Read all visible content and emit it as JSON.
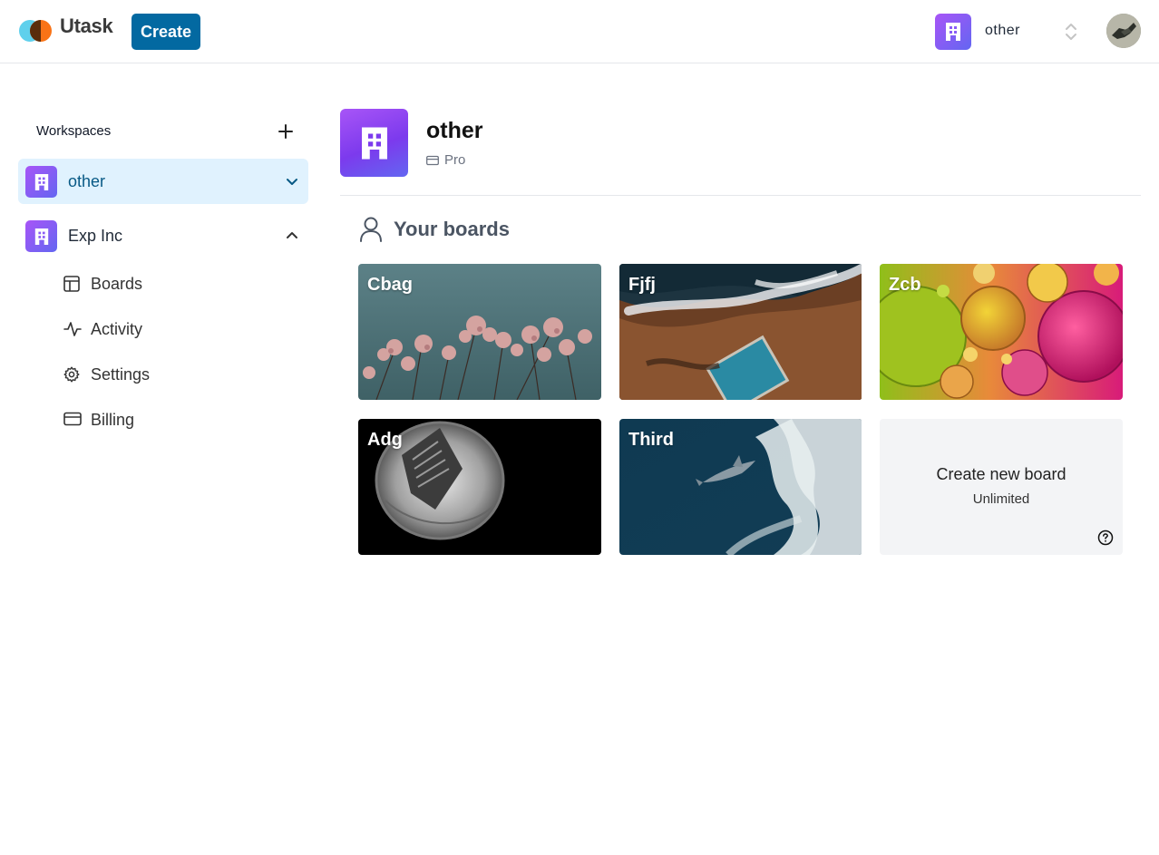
{
  "header": {
    "app_name": "Utask",
    "create_label": "Create",
    "current_workspace": "other"
  },
  "sidebar": {
    "heading": "Workspaces",
    "workspaces": [
      {
        "label": "other",
        "active": true
      },
      {
        "label": "Exp Inc",
        "active": false
      }
    ],
    "sub_items": [
      {
        "label": "Boards",
        "icon": "layout-icon"
      },
      {
        "label": "Activity",
        "icon": "activity-icon"
      },
      {
        "label": "Settings",
        "icon": "gear-icon"
      },
      {
        "label": "Billing",
        "icon": "credit-card-icon"
      }
    ]
  },
  "main": {
    "title": "other",
    "plan": "Pro",
    "boards_heading": "Your boards",
    "boards": [
      {
        "title": "Cbag"
      },
      {
        "title": "Fjfj"
      },
      {
        "title": "Zcb"
      },
      {
        "title": "Adg"
      },
      {
        "title": "Third"
      }
    ],
    "new_board": {
      "label": "Create new board",
      "sublabel": "Unlimited"
    }
  },
  "colors": {
    "accent": "#0369a1",
    "active_bg": "#e0f2fe",
    "workspace_gradient_start": "#a855f7",
    "workspace_gradient_end": "#6366f1"
  }
}
